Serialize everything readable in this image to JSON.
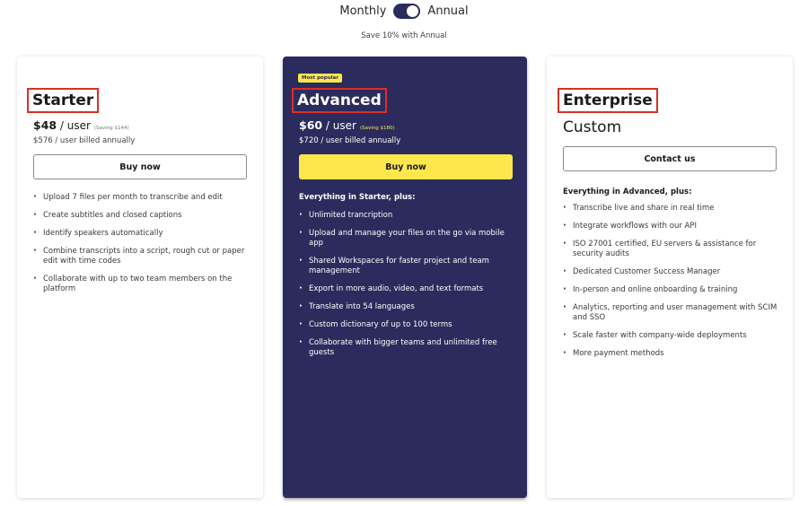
{
  "billing": {
    "monthly_label": "Monthly",
    "annual_label": "Annual",
    "selected": "Annual",
    "save_note": "Save 10% with Annual"
  },
  "plans": {
    "starter": {
      "name": "Starter",
      "price": "$48",
      "per": " / user",
      "saving": "(Saving $144)",
      "billed": "$576 / user billed annually",
      "cta": "Buy now",
      "features": [
        "Upload 7 files per month to transcribe and edit",
        "Create subtitles and closed captions",
        "Identify speakers automatically",
        "Combine transcripts into a script, rough cut or paper edit with time codes",
        "Collaborate with up to two team members on the platform"
      ]
    },
    "advanced": {
      "badge": "Most popular",
      "name": "Advanced",
      "price": "$60",
      "per": " / user",
      "saving": "(Saving $180)",
      "billed": "$720 / user billed annually",
      "cta": "Buy now",
      "features_heading": "Everything in Starter, plus:",
      "features": [
        "Unlimited trancription",
        "Upload and manage your files on the go via mobile app",
        "Shared Workspaces for faster project and team management",
        "Export in more audio, video, and text formats",
        "Translate into 54 languages",
        "Custom dictionary of up to 100 terms",
        "Collaborate with bigger teams and unlimited free guests"
      ]
    },
    "enterprise": {
      "name": "Enterprise",
      "price": "Custom",
      "cta": "Contact us",
      "features_heading": "Everything in Advanced, plus:",
      "features": [
        "Transcribe live and share in real time",
        "Integrate workflows with our API",
        "ISO 27001 certified, EU servers & assistance for security audits",
        "Dedicated Customer Success Manager",
        "In-person and online onboarding & training",
        "Analytics, reporting and user management with SCIM and SSO",
        "Scale faster with company-wide deployments",
        "More payment methods"
      ]
    }
  },
  "colors": {
    "highlight_card": "#2b2b5e",
    "accent_yellow": "#fde74c",
    "annotation_red": "#d93025"
  }
}
